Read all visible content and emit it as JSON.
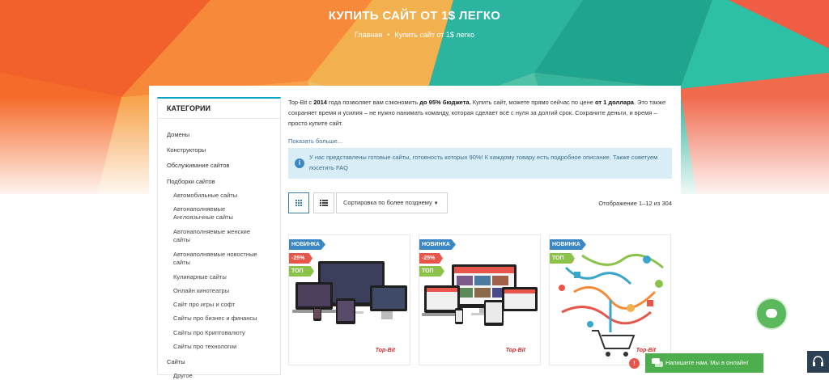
{
  "page": {
    "title": "КУПИТЬ САЙТ ОТ 1$ ЛЕГКО",
    "breadcrumb": {
      "home": "Главная",
      "separator": "•",
      "current": "Купить сайт от 1$ легко"
    }
  },
  "sidebar": {
    "title": "КАТЕГОРИИ",
    "items": [
      {
        "label": "Домены",
        "level": 0
      },
      {
        "label": "Конструкторы",
        "level": 0
      },
      {
        "label": "Обслуживание сайтов",
        "level": 0
      },
      {
        "label": "Подборки сайтов",
        "level": 0
      },
      {
        "label": "Автомобильные сайты",
        "level": 1
      },
      {
        "label": "Автонаполняемые Англоязычные сайты",
        "level": 1
      },
      {
        "label": "Автонаполняемые женские сайты",
        "level": 1
      },
      {
        "label": "Автонаполняемые новостные сайты",
        "level": 1
      },
      {
        "label": "Кулинарные сайты",
        "level": 1
      },
      {
        "label": "Онлайн кинотеатры",
        "level": 1
      },
      {
        "label": "Сайт про игры и софт",
        "level": 1
      },
      {
        "label": "Сайты про бизнес и финансы",
        "level": 1
      },
      {
        "label": "Сайты про Криптовалюту",
        "level": 1
      },
      {
        "label": "Сайты про технологии",
        "level": 1
      },
      {
        "label": "Сайты",
        "level": 0
      },
      {
        "label": "Другое",
        "level": 1
      }
    ]
  },
  "intro": {
    "p1": "Top-Bit с ",
    "year": "2014",
    "p2": " года позволяет вам сэкономить ",
    "savings": "до 95% бюджета.",
    "p3": " Купить сайт, можете прямо сейчас по цене ",
    "price": "от 1 доллара",
    "p4": ". Это также сохраняет время и усилия – не нужно нанимать команду, которая сделает всё с нуля за долгий срок. Сохраните деньги, и время – просто купите сайт.",
    "show_more": "Показать больше..."
  },
  "notice": {
    "icon": "info-icon",
    "text": "У нас представлены готовые сайты, готовность которых 90%! К каждому товару есть подробное описание. Также советуем посетить FAQ"
  },
  "toolbar": {
    "sort_label": "Сортировка по более позднему",
    "result_count": "Отображение 1–12 из 304"
  },
  "products": [
    {
      "badges": {
        "new": "НОВИНКА",
        "sale": "-25%",
        "top": "ТОП"
      },
      "logo": "Top-Bit"
    },
    {
      "badges": {
        "new": "НОВИНКА",
        "sale": "-25%",
        "top": "ТОП"
      },
      "logo": "Top-Bit"
    },
    {
      "badges": {
        "new": "НОВИНКА",
        "top": "ТОП"
      },
      "logo": "Top-Bit"
    }
  ],
  "chat": {
    "label": "Напишите нам. Мы в онлайн!",
    "alert": "!"
  },
  "colors": {
    "accent": "#0aa5c5",
    "new_badge": "#3a87c4",
    "sale_badge": "#e8554a",
    "top_badge": "#8bc34a",
    "chat": "#4cae4c"
  }
}
